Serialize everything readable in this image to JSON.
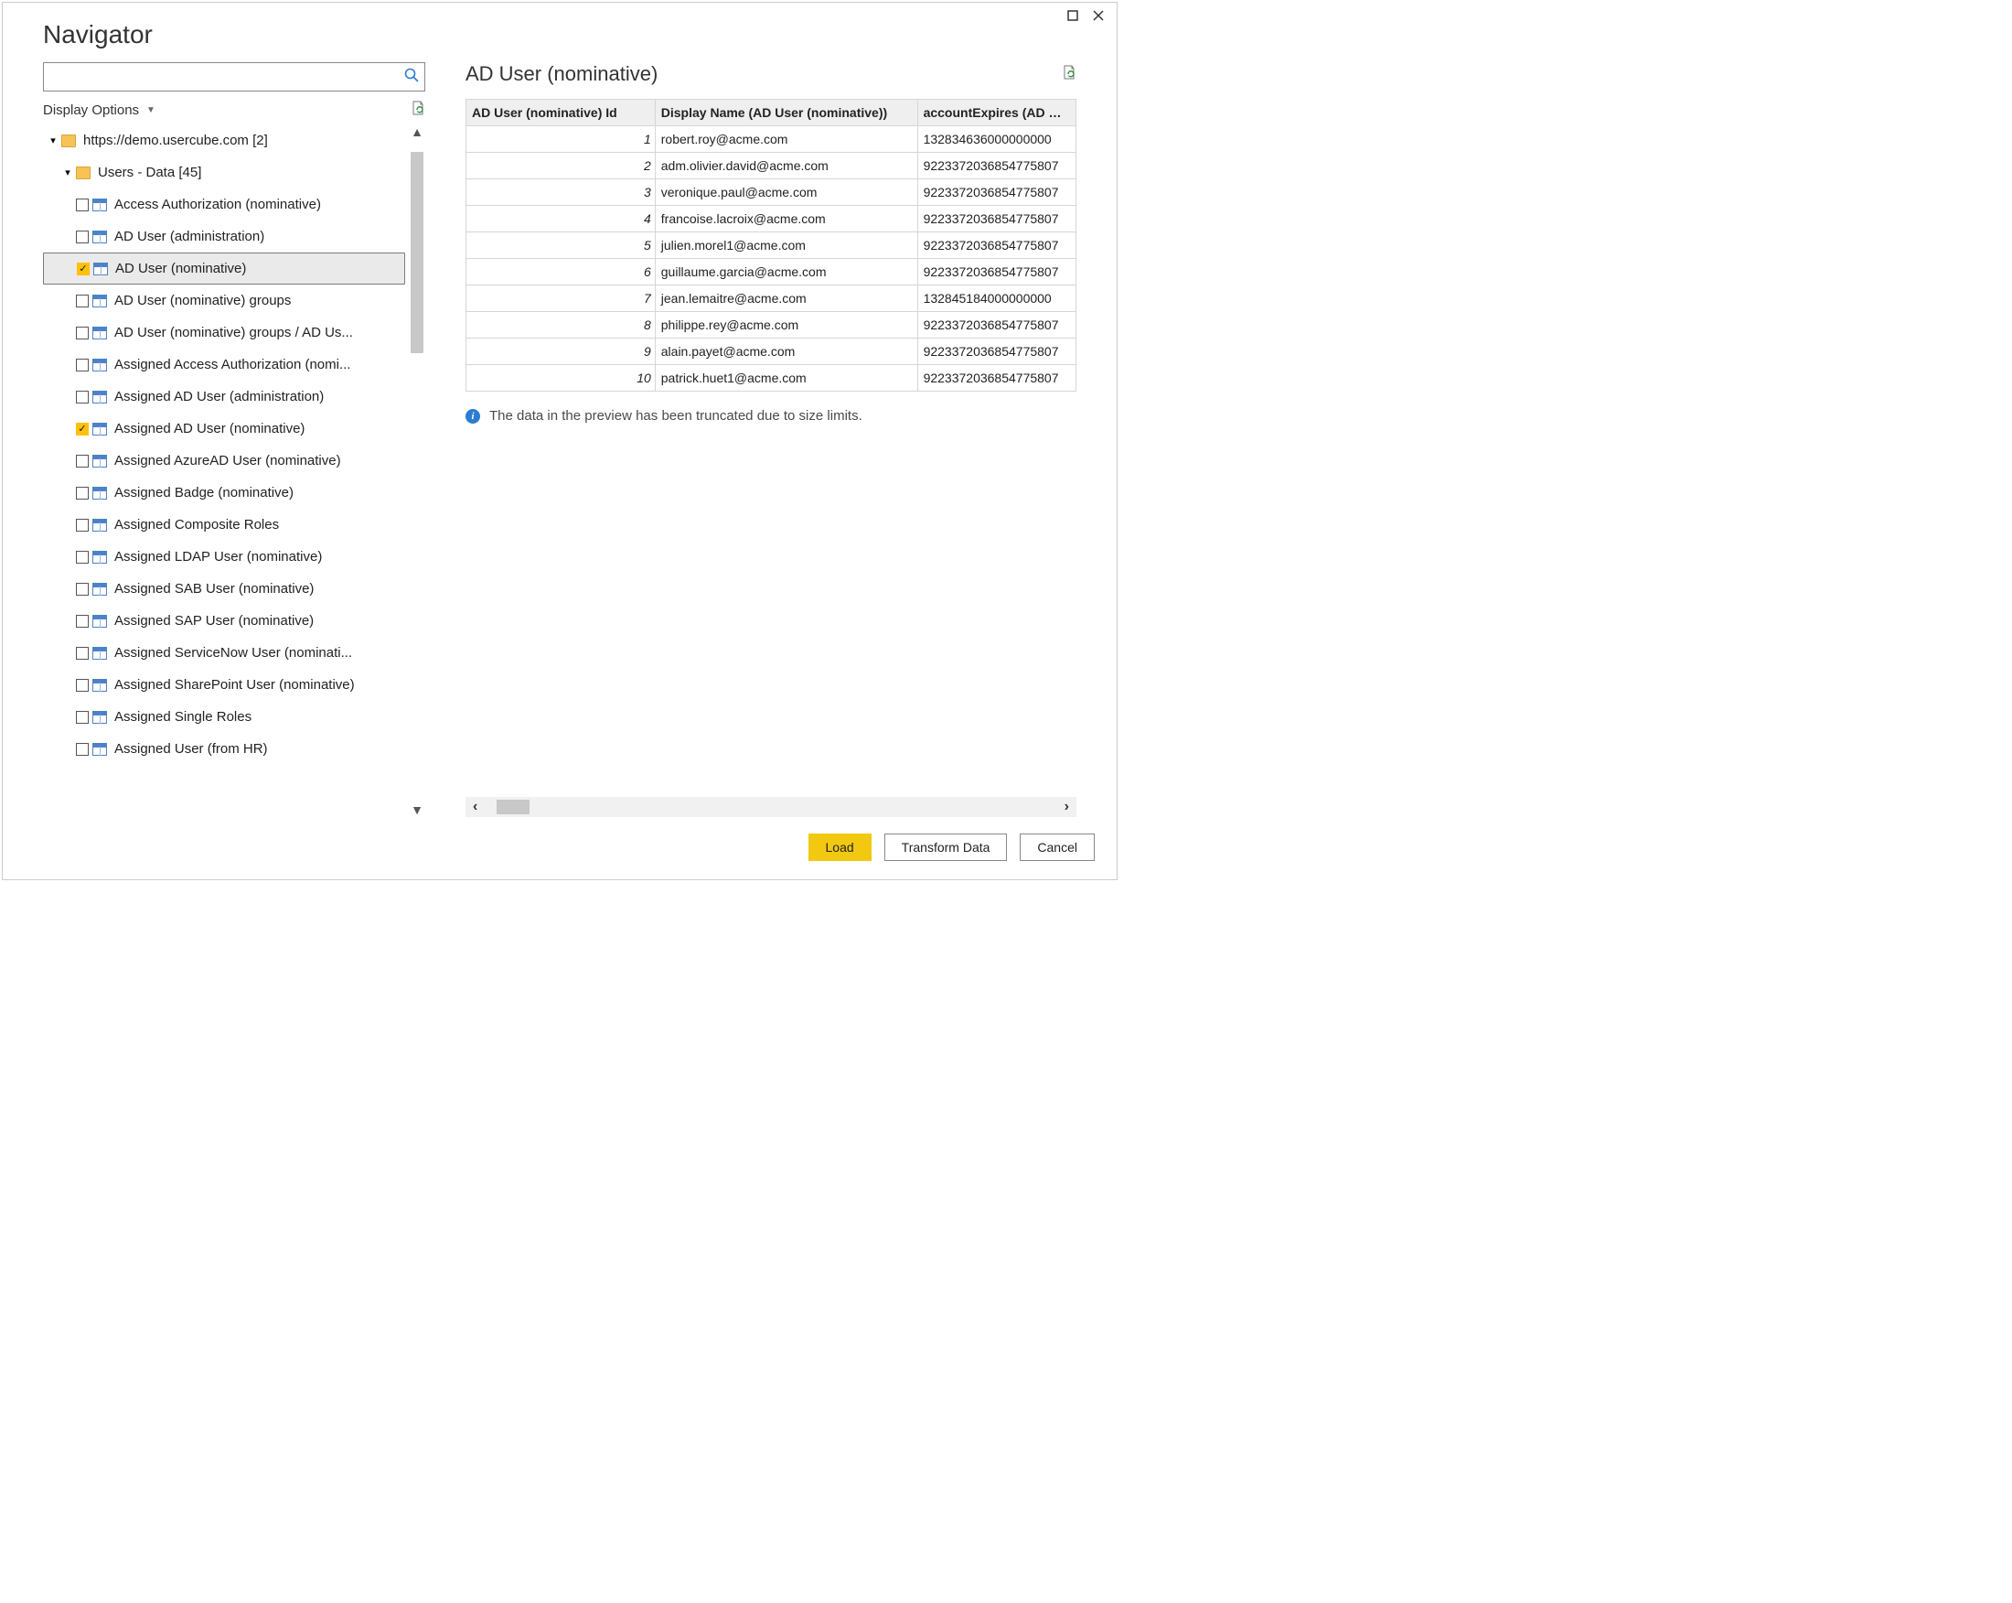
{
  "window": {
    "title": "Navigator"
  },
  "left": {
    "search": {
      "value": "",
      "placeholder": ""
    },
    "display_options_label": "Display Options",
    "tree": {
      "root_label": "https://demo.usercube.com [2]",
      "group_label": "Users - Data [45]",
      "items": [
        {
          "label": "Access Authorization (nominative)",
          "checked": false,
          "selected": false
        },
        {
          "label": "AD User (administration)",
          "checked": false,
          "selected": false
        },
        {
          "label": "AD User (nominative)",
          "checked": true,
          "selected": true
        },
        {
          "label": "AD User (nominative) groups",
          "checked": false,
          "selected": false
        },
        {
          "label": "AD User (nominative) groups / AD Us...",
          "checked": false,
          "selected": false
        },
        {
          "label": "Assigned Access Authorization (nomi...",
          "checked": false,
          "selected": false
        },
        {
          "label": "Assigned AD User (administration)",
          "checked": false,
          "selected": false
        },
        {
          "label": "Assigned AD User (nominative)",
          "checked": true,
          "selected": false
        },
        {
          "label": "Assigned AzureAD User (nominative)",
          "checked": false,
          "selected": false
        },
        {
          "label": "Assigned Badge (nominative)",
          "checked": false,
          "selected": false
        },
        {
          "label": "Assigned Composite Roles",
          "checked": false,
          "selected": false
        },
        {
          "label": "Assigned LDAP User (nominative)",
          "checked": false,
          "selected": false
        },
        {
          "label": "Assigned SAB User (nominative)",
          "checked": false,
          "selected": false
        },
        {
          "label": "Assigned SAP User (nominative)",
          "checked": false,
          "selected": false
        },
        {
          "label": "Assigned ServiceNow User (nominati...",
          "checked": false,
          "selected": false
        },
        {
          "label": "Assigned SharePoint User (nominative)",
          "checked": false,
          "selected": false
        },
        {
          "label": "Assigned Single Roles",
          "checked": false,
          "selected": false
        },
        {
          "label": "Assigned User (from HR)",
          "checked": false,
          "selected": false
        }
      ]
    }
  },
  "right": {
    "title": "AD User (nominative)",
    "columns": [
      "AD User (nominative) Id",
      "Display Name (AD User (nominative))",
      "accountExpires (AD Use"
    ],
    "rows": [
      {
        "id": "1",
        "name": "robert.roy@acme.com",
        "expires": "132834636000000000"
      },
      {
        "id": "2",
        "name": "adm.olivier.david@acme.com",
        "expires": "9223372036854775807"
      },
      {
        "id": "3",
        "name": "veronique.paul@acme.com",
        "expires": "9223372036854775807"
      },
      {
        "id": "4",
        "name": "francoise.lacroix@acme.com",
        "expires": "9223372036854775807"
      },
      {
        "id": "5",
        "name": "julien.morel1@acme.com",
        "expires": "9223372036854775807"
      },
      {
        "id": "6",
        "name": "guillaume.garcia@acme.com",
        "expires": "9223372036854775807"
      },
      {
        "id": "7",
        "name": "jean.lemaitre@acme.com",
        "expires": "132845184000000000"
      },
      {
        "id": "8",
        "name": "philippe.rey@acme.com",
        "expires": "9223372036854775807"
      },
      {
        "id": "9",
        "name": "alain.payet@acme.com",
        "expires": "9223372036854775807"
      },
      {
        "id": "10",
        "name": "patrick.huet1@acme.com",
        "expires": "9223372036854775807"
      }
    ],
    "truncated_msg": "The data in the preview has been truncated due to size limits."
  },
  "footer": {
    "load": "Load",
    "transform": "Transform Data",
    "cancel": "Cancel"
  }
}
